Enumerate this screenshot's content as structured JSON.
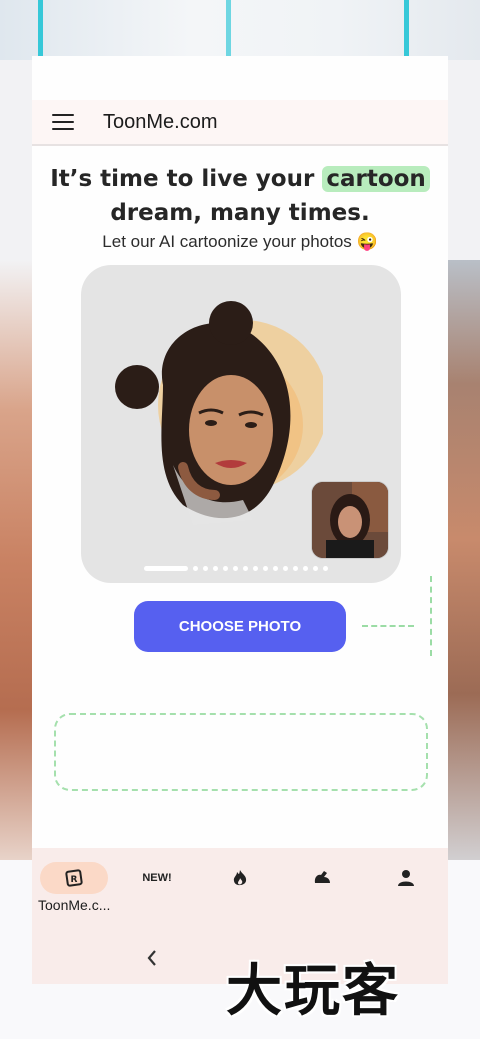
{
  "header": {
    "brand": "ToonMe.com",
    "menu_icon": "hamburger-menu-icon"
  },
  "hero": {
    "headline_part1": "It’s time to live your",
    "headline_highlight": "cartoon",
    "headline_part2": "dream, many times.",
    "subline": "Let our AI cartoonize your photos 😜",
    "highlight_color": "#b8ecbd"
  },
  "showcase": {
    "slide_count": 15,
    "active_slide": 1
  },
  "actions": {
    "choose_label": "CHOOSE PHOTO",
    "choose_color": "#5660f0"
  },
  "bottom_nav": {
    "items": [
      {
        "icon": "toonme-app-icon",
        "label": "ToonMe.c...",
        "selected": true
      },
      {
        "icon": "new-badge",
        "label": "NEW!"
      },
      {
        "icon": "fire-icon",
        "label": ""
      },
      {
        "icon": "muscle-arm-icon",
        "label": ""
      },
      {
        "icon": "person-icon",
        "label": ""
      }
    ]
  },
  "system_nav": {
    "back_icon": "back-chevron-icon"
  },
  "watermark": {
    "text": "大玩客"
  }
}
